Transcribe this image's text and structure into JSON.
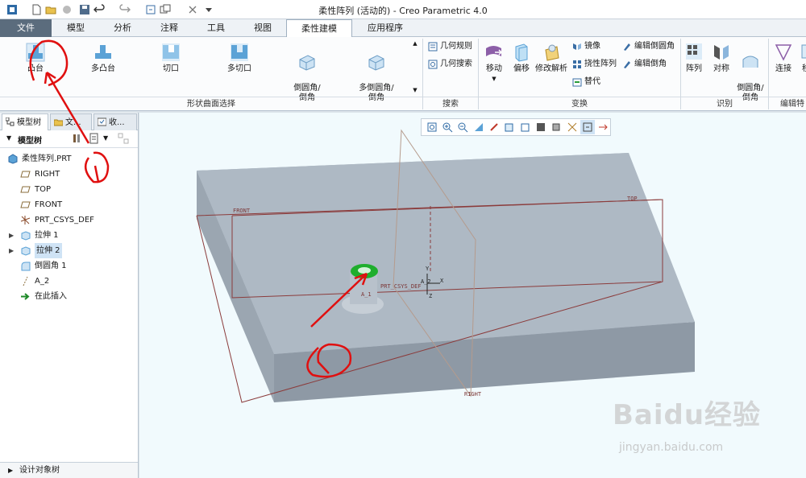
{
  "window": {
    "title": "柔性阵列 (活动的) - Creo Parametric 4.0"
  },
  "tabs": [
    {
      "label": "文件"
    },
    {
      "label": "模型"
    },
    {
      "label": "分析"
    },
    {
      "label": "注释"
    },
    {
      "label": "工具"
    },
    {
      "label": "视图"
    },
    {
      "label": "柔性建模"
    },
    {
      "label": "应用程序"
    }
  ],
  "ribbon": {
    "shape_group": {
      "label": "形状曲面选择",
      "buttons": [
        "凸台",
        "多凸台",
        "切口",
        "多切口",
        "倒圆角/\n倒角",
        "多倒圆角/\n倒角"
      ]
    },
    "search_group": {
      "label": "搜索",
      "buttons": [
        "几何规则",
        "几何搜索"
      ]
    },
    "transform_group": {
      "label": "变换",
      "buttons": [
        "移动",
        "偏移",
        "修改解析"
      ],
      "small": [
        "镜像",
        "挠性阵列",
        "替代",
        "编辑倒圆角",
        "编辑倒角"
      ]
    },
    "recognize_group": {
      "label": "识别",
      "buttons": [
        "阵列",
        "对称",
        "倒圆角/\n倒角"
      ]
    },
    "edit_group": {
      "label": "编辑特",
      "buttons": [
        "连接",
        "移"
      ]
    }
  },
  "panel": {
    "tabs": [
      "模型树",
      "文...",
      "收..."
    ],
    "tree_label": "模型树",
    "items": [
      {
        "label": "柔性阵列.PRT"
      },
      {
        "label": "RIGHT"
      },
      {
        "label": "TOP"
      },
      {
        "label": "FRONT"
      },
      {
        "label": "PRT_CSYS_DEF"
      },
      {
        "label": "拉伸 1"
      },
      {
        "label": "拉伸 2"
      },
      {
        "label": "倒圆角 1"
      },
      {
        "label": "A_2"
      },
      {
        "label": "在此插入"
      }
    ],
    "design_tree": "设计对象树"
  },
  "viewport": {
    "planes": {
      "front": "FRONT",
      "top": "TOP",
      "right": "RIGHT"
    },
    "csys": {
      "label": "PRT_CSYS_DEF",
      "axis": "A_2",
      "axis1": "A_1",
      "x": "X",
      "y": "Y",
      "z": "Z"
    }
  },
  "watermark": {
    "brand": "Baidu经验",
    "url": "jingyan.baidu.com"
  },
  "colors": {
    "accent": "#5b6c7d",
    "model": "#a5b1bd",
    "selection": "#1fae2d",
    "annotation": "#e01010"
  }
}
